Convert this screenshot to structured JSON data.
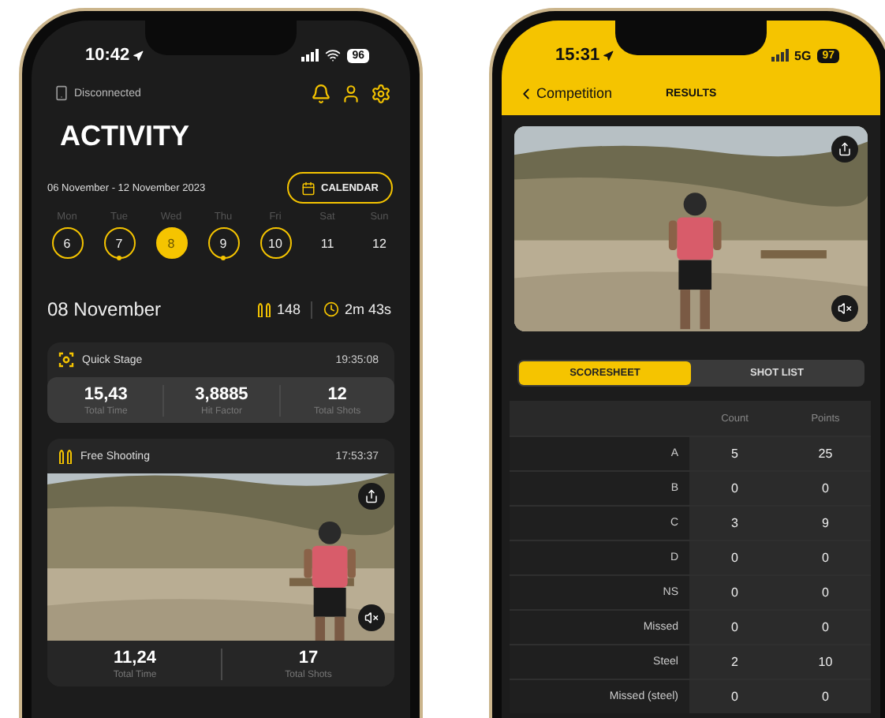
{
  "activity_screen": {
    "status_bar": {
      "time": "10:42",
      "battery": "96"
    },
    "connection": "Disconnected",
    "title": "ACTIVITY",
    "date_range": "06 November - 12 November 2023",
    "calendar_button": "CALENDAR",
    "days": [
      {
        "weekday": "Mon",
        "day": "6",
        "selected": false,
        "ring": true,
        "dot": false
      },
      {
        "weekday": "Tue",
        "day": "7",
        "selected": false,
        "ring": true,
        "dot": true
      },
      {
        "weekday": "Wed",
        "day": "8",
        "selected": true,
        "ring": true,
        "dot": false
      },
      {
        "weekday": "Thu",
        "day": "9",
        "selected": false,
        "ring": true,
        "dot": true
      },
      {
        "weekday": "Fri",
        "day": "10",
        "selected": false,
        "ring": true,
        "dot": false
      },
      {
        "weekday": "Sat",
        "day": "11",
        "selected": false,
        "ring": false,
        "dot": false
      },
      {
        "weekday": "Sun",
        "day": "12",
        "selected": false,
        "ring": false,
        "dot": false
      }
    ],
    "summary": {
      "date": "08 November",
      "shots": "148",
      "duration": "2m 43s"
    },
    "sessions": [
      {
        "kind": "stage",
        "title": "Quick Stage",
        "time": "19:35:08",
        "stats": [
          {
            "value": "15,43",
            "label": "Total Time"
          },
          {
            "value": "3,8885",
            "label": "Hit Factor"
          },
          {
            "value": "12",
            "label": "Total Shots"
          }
        ]
      },
      {
        "kind": "free",
        "title": "Free Shooting",
        "time": "17:53:37",
        "video": {
          "kind": "picture"
        },
        "stats": [
          {
            "value": "11,24",
            "label": "Total Time"
          },
          {
            "value": "17",
            "label": "Total Shots"
          }
        ]
      }
    ]
  },
  "results_screen": {
    "status_bar": {
      "time": "15:31",
      "network": "5G",
      "battery": "97"
    },
    "back_label": "Competition",
    "title": "RESULTS",
    "video": {
      "kind": "picture"
    },
    "tabs": [
      {
        "label": "SCORESHEET",
        "selected": true
      },
      {
        "label": "SHOT LIST",
        "selected": false
      }
    ],
    "table": {
      "columns": [
        "Count",
        "Points"
      ],
      "rows": [
        {
          "label": "A",
          "count": "5",
          "points": "25"
        },
        {
          "label": "B",
          "count": "0",
          "points": "0"
        },
        {
          "label": "C",
          "count": "3",
          "points": "9"
        },
        {
          "label": "D",
          "count": "0",
          "points": "0"
        },
        {
          "label": "NS",
          "count": "0",
          "points": "0"
        },
        {
          "label": "Missed",
          "count": "0",
          "points": "0"
        },
        {
          "label": "Steel",
          "count": "2",
          "points": "10"
        },
        {
          "label": "Missed (steel)",
          "count": "0",
          "points": "0"
        }
      ]
    }
  }
}
